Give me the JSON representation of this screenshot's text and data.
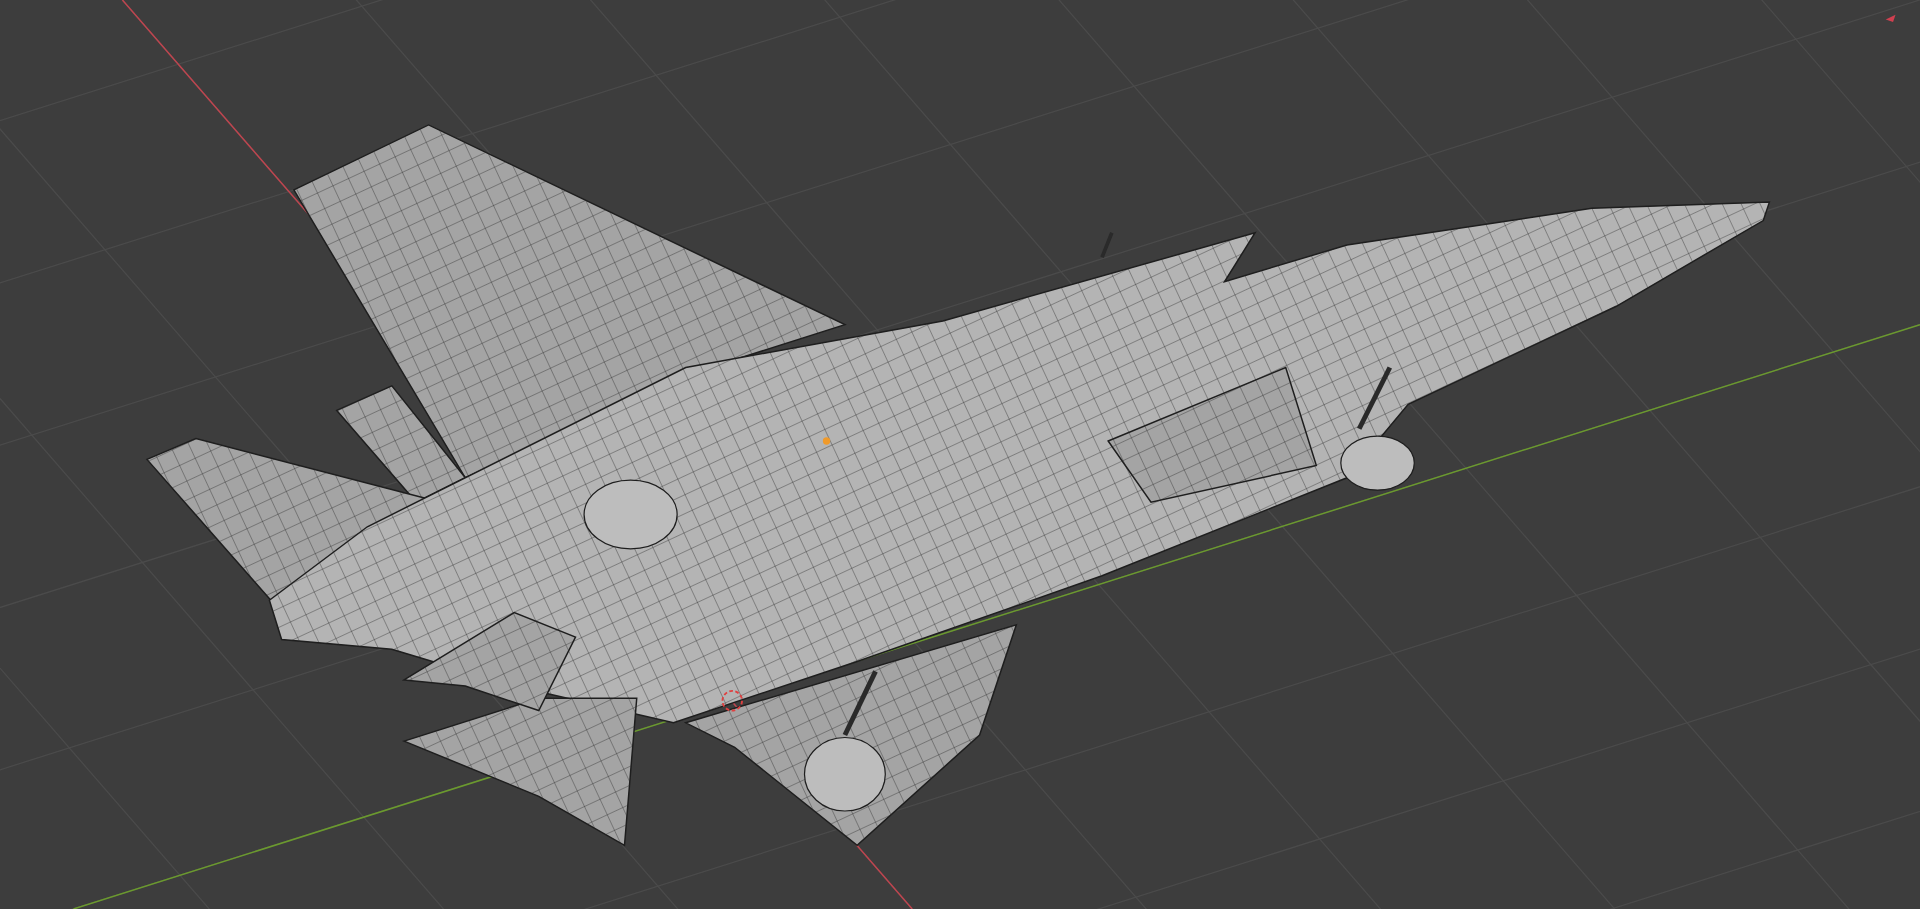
{
  "viewport": {
    "grid": true,
    "axes": [
      {
        "kind": "x",
        "color": "#c0454f"
      },
      {
        "kind": "y",
        "color": "#6b9a2e"
      }
    ]
  }
}
